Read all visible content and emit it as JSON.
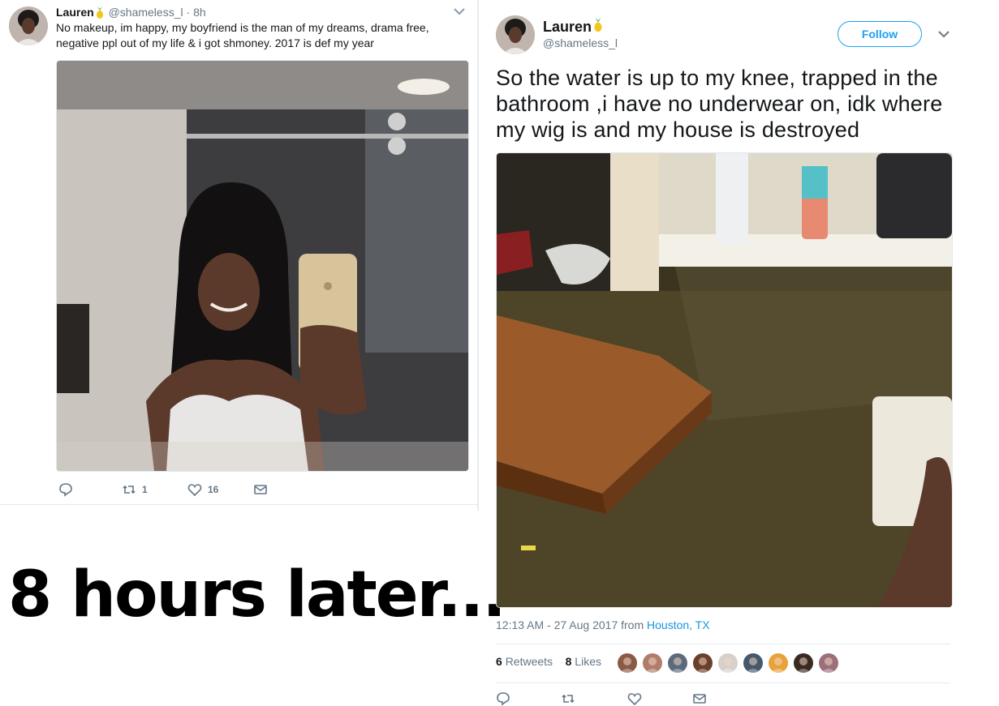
{
  "left_tweet": {
    "display_name": "Lauren",
    "handle": "@shameless_l",
    "separator": " · ",
    "time": "8h",
    "text": "No makeup, im happy, my boyfriend is the man of my dreams, drama free, negative ppl out of my life & i got shmoney. 2017 is def my year",
    "retweets": "1",
    "likes": "16",
    "icons": [
      "reply-icon",
      "retweet-icon",
      "like-icon",
      "direct-message-icon"
    ]
  },
  "caption": "8 hours later...",
  "right_tweet": {
    "display_name": "Lauren",
    "handle": "@shameless_l",
    "follow_label": "Follow",
    "text": "So the water is up to my knee, trapped in the bathroom ,i have no underwear on, idk where my wig is and my house is destroyed",
    "timestamp": "12:13 AM - 27 Aug 2017 from ",
    "location": "Houston, TX",
    "retweet_count": "6",
    "retweet_label": "Retweets",
    "like_count": "8",
    "like_label": "Likes",
    "liker_avatar_colors": [
      "#8a5a44",
      "#b07d6a",
      "#5b6b7d",
      "#6b3f2a",
      "#d8d0cc",
      "#46586a",
      "#e8a23a",
      "#3b2a22",
      "#9c6f7a"
    ]
  },
  "colors": {
    "accent": "#1da1f2",
    "secondary_text": "#657786",
    "link": "#1b95e0"
  }
}
